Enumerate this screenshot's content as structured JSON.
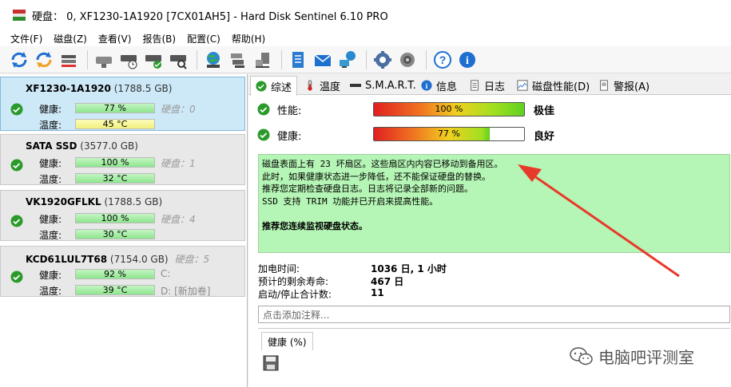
{
  "title": "硬盘： 0, XF1230-1A1920 [7CX01AH5]  -  Hard Disk Sentinel 6.10 PRO",
  "menu": [
    "文件(F)",
    "磁盘(Z)",
    "查看(V)",
    "报告(B)",
    "配置(C)",
    "帮助(H)"
  ],
  "disks": [
    {
      "name": "XF1230-1A1920",
      "size": "(1788.5 GB)",
      "health_label": "健康:",
      "health": "77 %",
      "temp_label": "温度:",
      "temp": "45 °C",
      "hint": "硬盘：0",
      "temp_color": "yellow"
    },
    {
      "name": "SATA SSD",
      "size": "(3577.0 GB)",
      "health_label": "健康:",
      "health": "100 %",
      "temp_label": "温度:",
      "temp": "32 °C",
      "hint": "硬盘：1",
      "temp_color": "green"
    },
    {
      "name": "VK1920GFLKL",
      "size": "(1788.5 GB)",
      "health_label": "健康:",
      "health": "100 %",
      "temp_label": "温度:",
      "temp": "30 °C",
      "hint": "硬盘：4",
      "temp_color": "green"
    },
    {
      "name": "KCD61LUL7T68",
      "size": "(7154.0 GB)",
      "header_hint": "硬盘：5",
      "health_label": "健康:",
      "health": "92 %",
      "temp_label": "温度:",
      "temp": "39 °C",
      "hint": "C:",
      "hint2": "D: [新加卷]",
      "temp_color": "green"
    }
  ],
  "tabs": [
    "综述",
    "温度",
    "S.M.A.R.T.",
    "信息",
    "日志",
    "磁盘性能(D)",
    "警报(A)"
  ],
  "summary": {
    "performance_label": "性能:",
    "performance_value": "100 %",
    "performance_word": "极佳",
    "health_label": "健康:",
    "health_value": "77 %",
    "health_word": "良好"
  },
  "message": {
    "lines": [
      "磁盘表面上有 23 坏扇区。这些扇区内内容已移动到备用区。",
      "此时，如果健康状态进一步降低，还不能保证硬盘的替换。",
      "推荐您定期检查硬盘日志。日志将记录全部新的问题。",
      "SSD 支持 TRIM 功能并已开启来提高性能。"
    ],
    "recommend": "推荐您连续监视硬盘状态。"
  },
  "info": [
    {
      "label": "加电时间:",
      "value": "1036 日, 1 小时"
    },
    {
      "label": "预计的剩余寿命:",
      "value": "467 日"
    },
    {
      "label": "启动/停止合计数:",
      "value": "11"
    }
  ],
  "note_placeholder": "点击添加注释...",
  "health_tab": "健康 (%)",
  "watermark": "电脑吧评测室"
}
